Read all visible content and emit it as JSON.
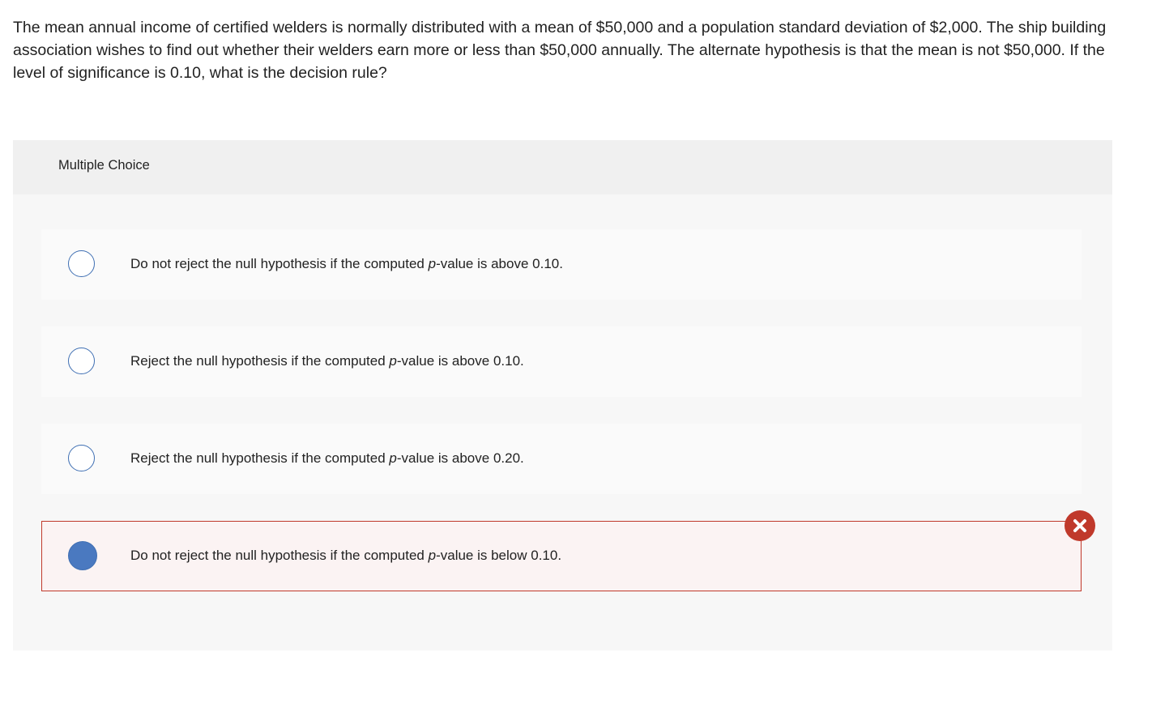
{
  "question": {
    "text": "The mean annual income of certified welders is normally distributed with a mean of $50,000 and a population standard deviation of $2,000. The ship building association wishes to find out whether their welders earn more or less than $50,000 annually. The alternate hypothesis is that the mean is not $50,000. If the level of significance is 0.10, what is the decision rule?"
  },
  "panel": {
    "title": "Multiple Choice"
  },
  "options": [
    {
      "before": "Do not reject the null hypothesis if the computed ",
      "italic": "p",
      "after": "-value is above 0.10.",
      "selected": false
    },
    {
      "before": "Reject the null hypothesis if the computed ",
      "italic": "p",
      "after": "-value is above 0.10.",
      "selected": false
    },
    {
      "before": "Reject the null hypothesis if the computed ",
      "italic": "p",
      "after": "-value is above 0.20.",
      "selected": false
    },
    {
      "before": "Do not reject the null hypothesis if the computed ",
      "italic": "p",
      "after": "-value is below 0.10.",
      "selected": true,
      "status": "incorrect"
    }
  ],
  "colors": {
    "accent": "#3f6fb3",
    "selected_fill": "#4a79c0",
    "error": "#c0392b"
  },
  "icons": {
    "incorrect": "close-icon"
  }
}
